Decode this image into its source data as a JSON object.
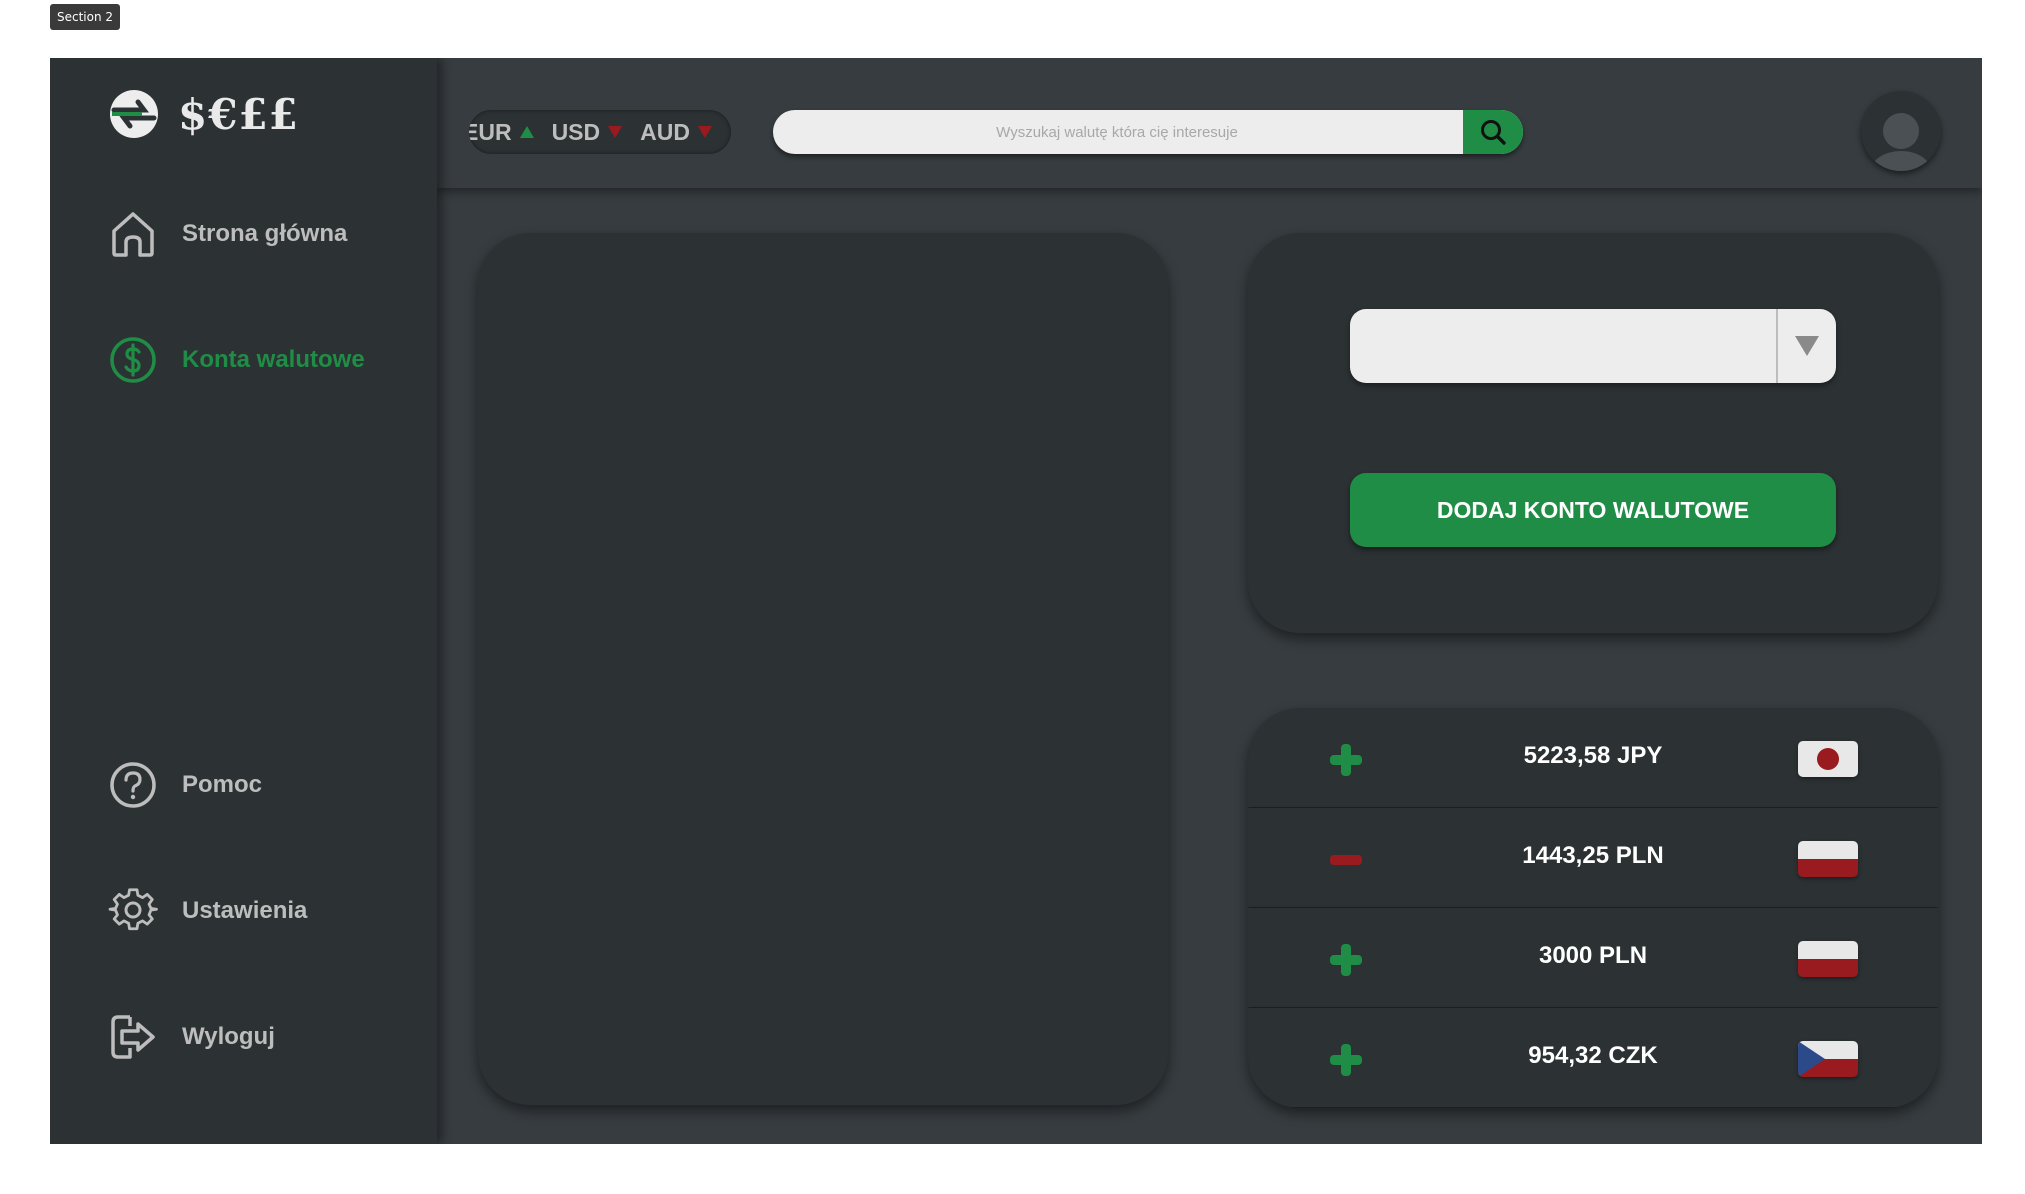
{
  "section_tag": "Section 2",
  "brand": {
    "logo_text": "$€££"
  },
  "sidebar": {
    "items": [
      {
        "label": "Strona główna",
        "icon": "home-icon"
      },
      {
        "label": "Konta walutowe",
        "icon": "dollar-circle-icon",
        "active": true
      },
      {
        "label": "Pomoc",
        "icon": "help-icon"
      },
      {
        "label": "Ustawienia",
        "icon": "gear-icon"
      },
      {
        "label": "Wyloguj",
        "icon": "logout-icon"
      }
    ]
  },
  "header": {
    "ticker": [
      {
        "code": "EUR",
        "trend": "up"
      },
      {
        "code": "USD",
        "trend": "down"
      },
      {
        "code": "AUD",
        "trend": "down"
      }
    ],
    "search": {
      "placeholder": "Wyszukaj walutę która cię interesuje",
      "value": ""
    }
  },
  "add_account": {
    "select_value": "",
    "button_label": "DODAJ KONTO WALUTOWE"
  },
  "accounts": [
    {
      "amount": "5223,58 JPY",
      "sign": "plus",
      "flag": "japan"
    },
    {
      "amount": "1443,25 PLN",
      "sign": "minus",
      "flag": "poland"
    },
    {
      "amount": "3000 PLN",
      "sign": "plus",
      "flag": "poland"
    },
    {
      "amount": "954,32 CZK",
      "sign": "plus",
      "flag": "czechia"
    }
  ],
  "colors": {
    "accent_green": "#1f8d45",
    "down_red": "#9a1b1f",
    "panel": "#2c3234",
    "background": "#363c3f"
  }
}
